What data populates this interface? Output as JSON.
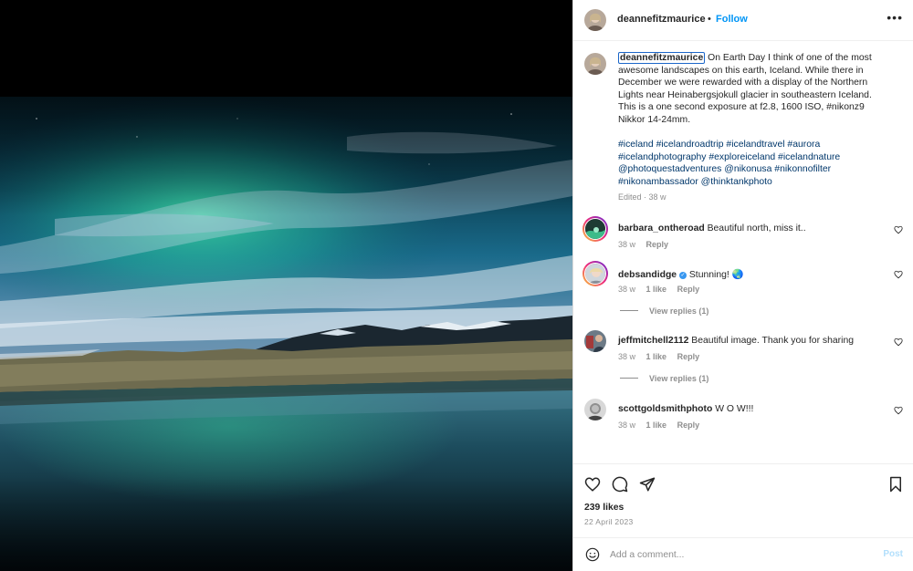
{
  "post": {
    "username": "deannefitzmaurice",
    "separator": "•",
    "follow_label": "Follow",
    "more_icon": "more-horizontal-icon",
    "photo_alt": "Northern lights over a glacier lagoon in Iceland"
  },
  "caption": {
    "username": "deannefitzmaurice",
    "text": "On Earth Day I think of one of the most awesome landscapes on this earth, Iceland. While there in December we were rewarded with a display of the Northern Lights near Heinabergsjokull glacier in southeastern Iceland. This is a one second exposure at f2.8, 1600 ISO, #nikonz9 Nikkor 14-24mm.",
    "hashtags": "#iceland #icelandroadtrip #icelandtravel #aurora #icelandphotography #exploreiceland #icelandnature @photoquestadventures @nikonusa #nikonnofilter #nikonambassador @thinktankphoto",
    "edited": "Edited · 38 w"
  },
  "comments": [
    {
      "username": "barbara_ontheroad",
      "text": "Beautiful north, miss it..",
      "age": "38 w",
      "likes": "",
      "reply_label": "Reply",
      "verified": false,
      "view_replies": ""
    },
    {
      "username": "debsandidge",
      "text": "Stunning! 🌏",
      "age": "38 w",
      "likes": "1 like",
      "reply_label": "Reply",
      "verified": true,
      "view_replies": "View replies (1)"
    },
    {
      "username": "jeffmitchell2112",
      "text": "Beautiful image. Thank you for sharing",
      "age": "38 w",
      "likes": "1 like",
      "reply_label": "Reply",
      "verified": false,
      "view_replies": "View replies (1)"
    },
    {
      "username": "scottgoldsmithphoto",
      "text": "W O W!!!",
      "age": "38 w",
      "likes": "1 like",
      "reply_label": "Reply",
      "verified": false,
      "view_replies": ""
    }
  ],
  "actions": {
    "like_icon": "heart-icon",
    "comment_icon": "comment-bubble-icon",
    "share_icon": "paper-plane-icon",
    "save_icon": "bookmark-icon"
  },
  "stats": {
    "likes": "239 likes",
    "date": "22 April 2023"
  },
  "add_comment": {
    "placeholder": "Add a comment...",
    "post_label": "Post",
    "emoji_icon": "smiley-face-icon"
  },
  "colors": {
    "follow": "#0095f6",
    "post_disabled": "#b2dffc",
    "hashtag": "#00376b",
    "muted": "#8e8e8e"
  }
}
